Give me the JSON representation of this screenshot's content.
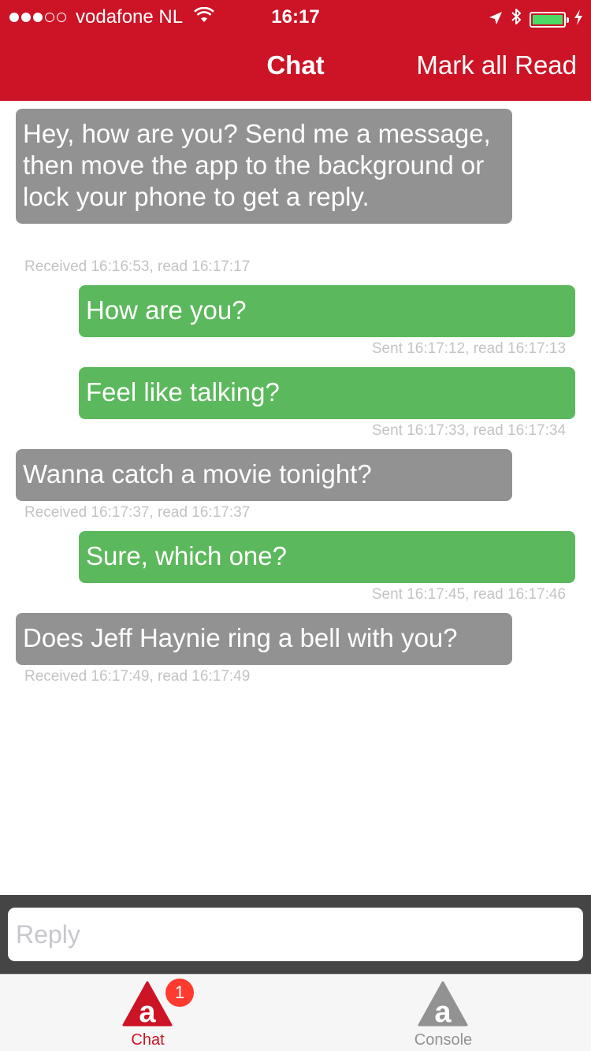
{
  "status_bar": {
    "carrier": "vodafone NL",
    "time": "16:17",
    "signal_bars_full": 3,
    "signal_bars_total": 5,
    "battery_level": 1.0
  },
  "nav": {
    "title": "Chat",
    "mark_all_read": "Mark all Read"
  },
  "messages": [
    {
      "direction": "in",
      "text": "Hey, how are you? Send me a message, then move the app to the background or lock your phone to get a reply.",
      "meta": "Received 16:16:53, read 16:17:17"
    },
    {
      "direction": "out",
      "text": "How are you?",
      "meta": "Sent 16:17:12, read 16:17:13"
    },
    {
      "direction": "out",
      "text": "Feel like talking?",
      "meta": "Sent 16:17:33, read 16:17:34"
    },
    {
      "direction": "in",
      "text": "Wanna catch a movie tonight?",
      "meta": "Received 16:17:37, read 16:17:37"
    },
    {
      "direction": "out",
      "text": "Sure, which one?",
      "meta": "Sent 16:17:45, read 16:17:46"
    },
    {
      "direction": "in",
      "text": "Does Jeff Haynie ring a bell with you?",
      "meta": "Received 16:17:49, read 16:17:49"
    }
  ],
  "reply": {
    "placeholder": "Reply",
    "value": ""
  },
  "tabs": [
    {
      "label": "Chat",
      "icon": "appcelerator-logo-icon",
      "badge": "1",
      "active": true
    },
    {
      "label": "Console",
      "icon": "appcelerator-logo-icon",
      "active": false
    }
  ],
  "colors": {
    "header": "#cc1426",
    "incoming_bubble": "#929292",
    "outgoing_bubble": "#5cb85c",
    "battery": "#4cd964",
    "badge": "#ff3b30"
  }
}
